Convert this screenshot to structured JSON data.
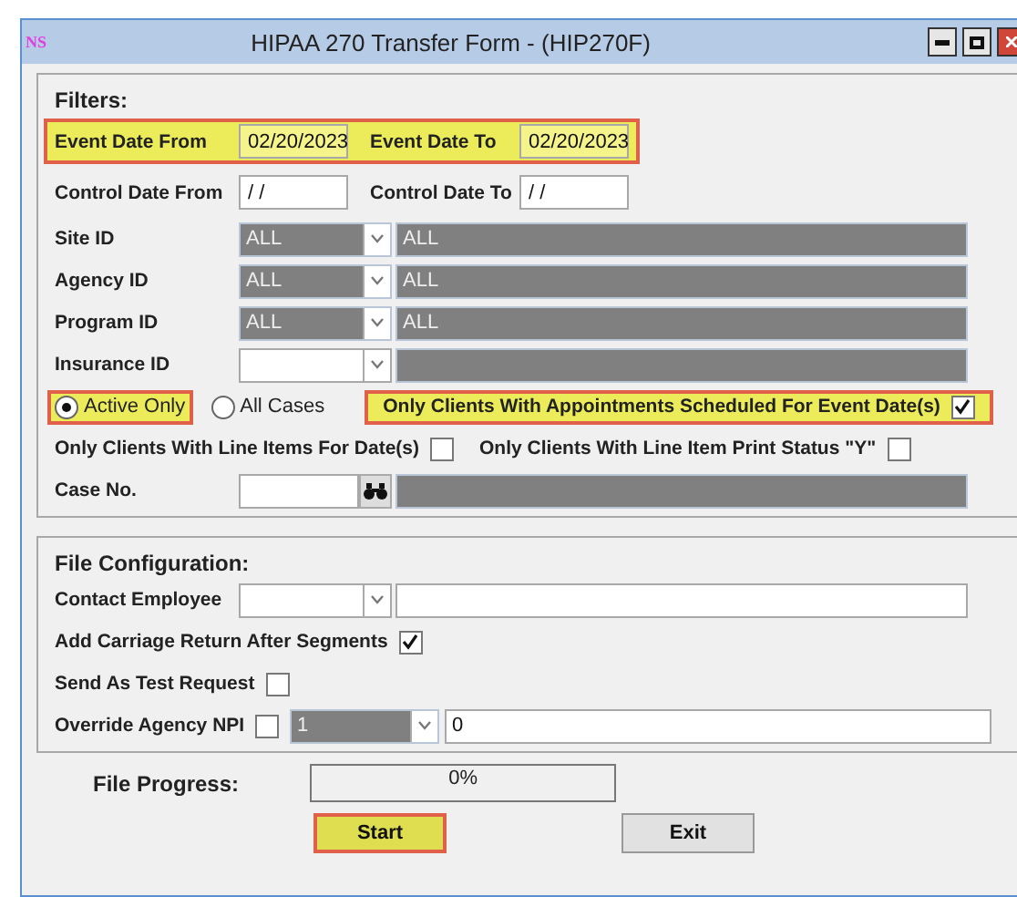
{
  "window": {
    "logo": "NS",
    "title": "HIPAA 270 Transfer Form - (HIP270F)"
  },
  "filters": {
    "heading": "Filters:",
    "event_dates": {
      "highlighted": true,
      "from_label": "Event Date From",
      "from_value": "02/20/2023",
      "to_label": "Event Date To",
      "to_value": "02/20/2023"
    },
    "control_dates": {
      "highlighted": false,
      "from_label": "Control Date From",
      "from_value": "/ /",
      "to_label": "Control Date To",
      "to_value": "/ /"
    },
    "lookups": [
      {
        "label": "Site ID",
        "code": "ALL",
        "description": "ALL",
        "disabled": true
      },
      {
        "label": "Agency ID",
        "code": "ALL",
        "description": "ALL",
        "disabled": true
      },
      {
        "label": "Program ID",
        "code": "ALL",
        "description": "ALL",
        "disabled": true
      },
      {
        "label": "Insurance ID",
        "disabled": false
      }
    ],
    "radios": [
      {
        "label": "Active Only",
        "selected": true,
        "highlighted": true
      },
      {
        "label": "All Cases",
        "selected": false,
        "highlighted": false
      }
    ],
    "appointments": {
      "label": "Only Clients With Appointments Scheduled For Event Date(s)",
      "checked": true,
      "highlighted": true
    },
    "line_checks": [
      {
        "label": "Only Clients With Line Items For Date(s)",
        "checked": false
      },
      {
        "label": "Only Clients With Line Item Print Status \"Y\"",
        "checked": false
      }
    ],
    "case_no": {
      "label": "Case No."
    }
  },
  "file_configuration": {
    "heading": "File Configuration:",
    "contact_employee": {
      "label": "Contact Employee"
    },
    "carriage_return": {
      "label": "Add Carriage Return After Segments",
      "checked": true
    },
    "test_request": {
      "label": "Send As Test Request",
      "checked": false
    },
    "override_npi": {
      "label": "Override Agency NPI",
      "checked": false,
      "code": "1",
      "value": "0"
    }
  },
  "progress": {
    "label": "File Progress:",
    "text": "0%",
    "level": 0
  },
  "buttons": [
    {
      "label": "Start",
      "highlighted": true
    },
    {
      "label": "Exit",
      "highlighted": false
    }
  ]
}
